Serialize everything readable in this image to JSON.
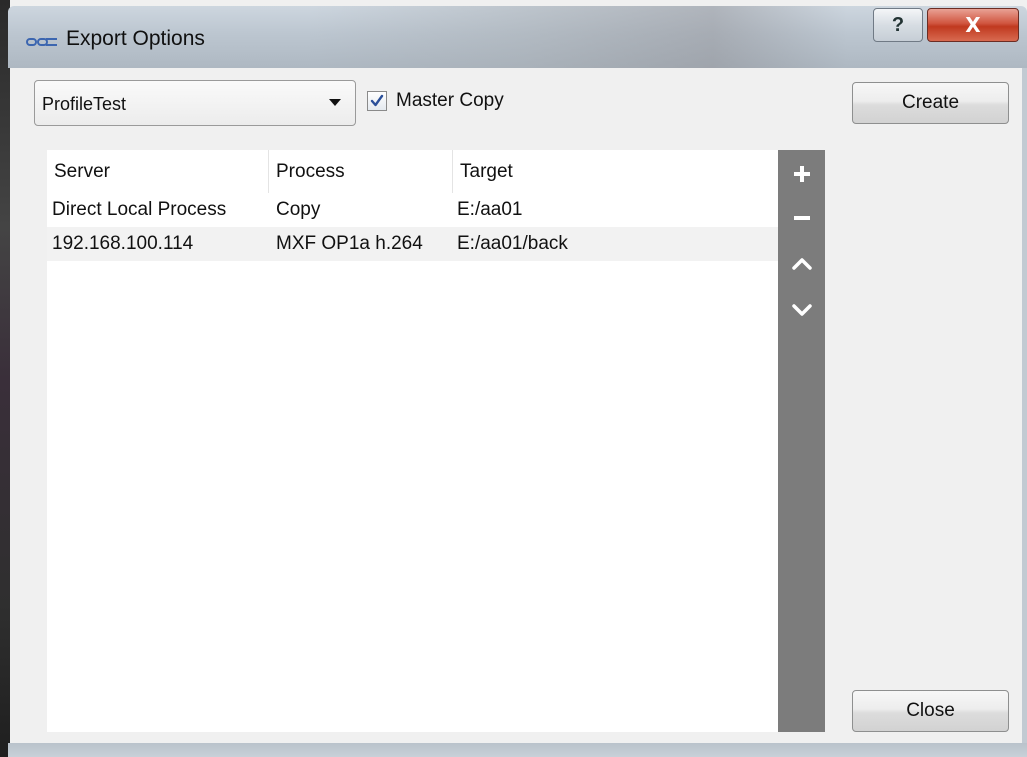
{
  "window": {
    "title": "Export Options",
    "help_label": "?",
    "close_label": "X"
  },
  "profile": {
    "selected": "ProfileTest"
  },
  "master_copy": {
    "label": "Master Copy",
    "checked": true
  },
  "buttons": {
    "create": "Create",
    "close": "Close"
  },
  "table": {
    "columns": [
      "Server",
      "Process",
      "Target"
    ],
    "rows": [
      {
        "server": "Direct Local Process",
        "process": "Copy",
        "target": "E:/aa01"
      },
      {
        "server": "192.168.100.114",
        "process": "MXF OP1a h.264",
        "target": "E:/aa01/back"
      }
    ]
  },
  "toolbar": {
    "icons": [
      "plus-icon",
      "minus-icon",
      "chevron-up-icon",
      "chevron-down-icon"
    ]
  },
  "colors": {
    "toolbar_bg": "#7c7c7c",
    "check_mark": "#2a4f9a",
    "close_btn": "#c0391f"
  }
}
